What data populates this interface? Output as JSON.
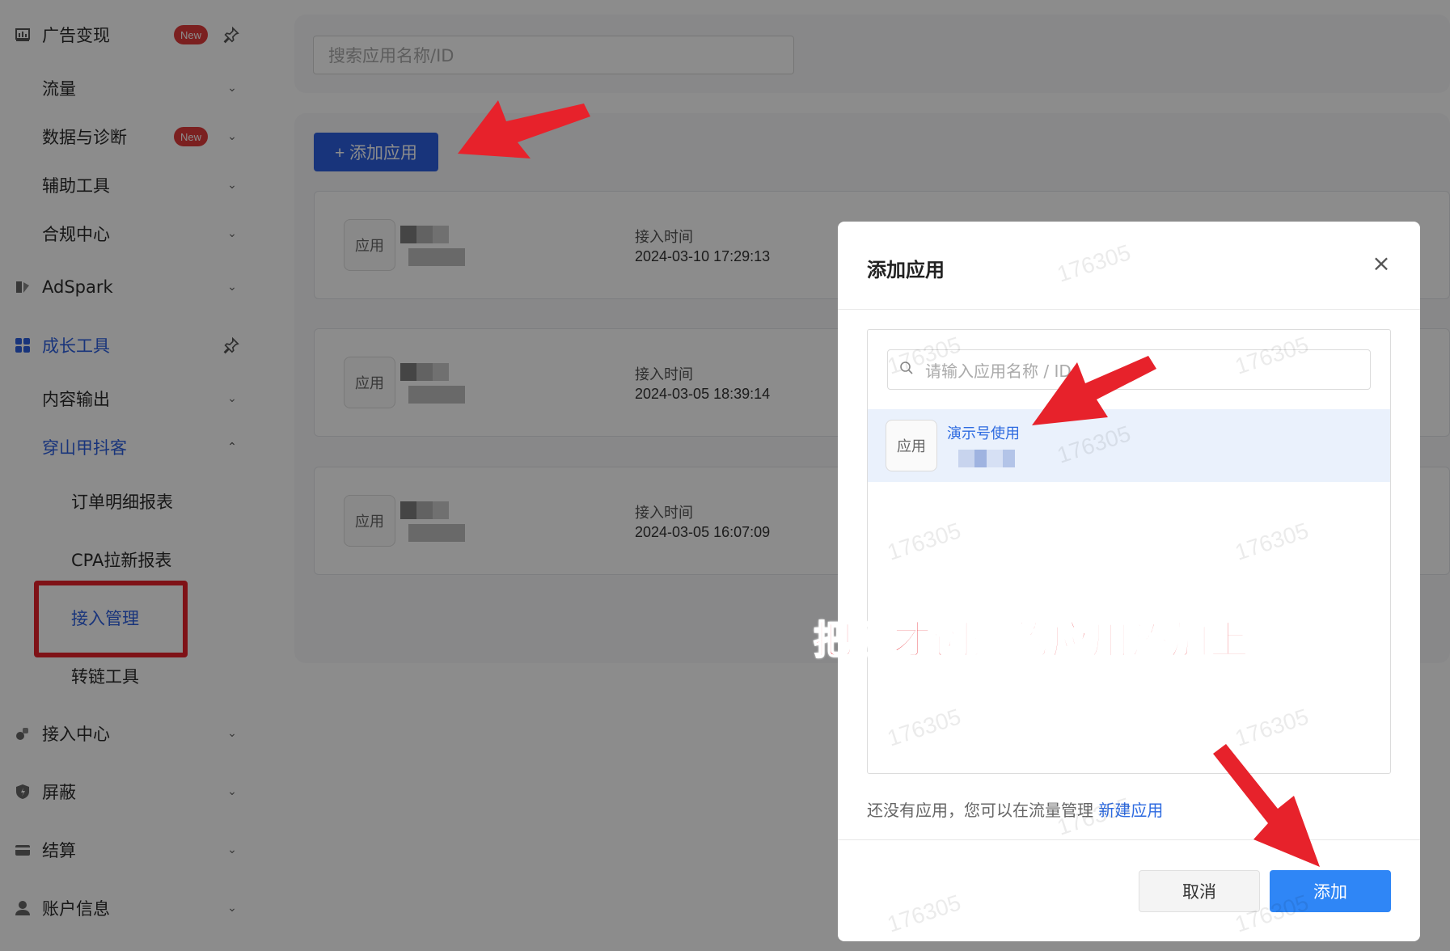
{
  "sidebar": {
    "items": [
      {
        "label": "广告变现",
        "badge": "New",
        "icon": "chart-icon"
      },
      {
        "label": "流量"
      },
      {
        "label": "数据与诊断",
        "badge": "New"
      },
      {
        "label": "辅助工具"
      },
      {
        "label": "合规中心"
      },
      {
        "label": "AdSpark",
        "icon": "adspark-icon"
      },
      {
        "label": "成长工具",
        "icon": "grid-icon"
      },
      {
        "label": "内容输出"
      },
      {
        "label": "穿山甲抖客"
      },
      {
        "label": "订单明细报表"
      },
      {
        "label": "CPA拉新报表"
      },
      {
        "label": "接入管理"
      },
      {
        "label": "转链工具"
      },
      {
        "label": "接入中心",
        "icon": "plug-icon"
      },
      {
        "label": "屏蔽",
        "icon": "shield-icon"
      },
      {
        "label": "结算",
        "icon": "card-icon"
      },
      {
        "label": "账户信息",
        "icon": "user-icon"
      }
    ]
  },
  "main": {
    "search_placeholder": "搜索应用名称/ID",
    "add_button": "+ 添加应用",
    "cards": [
      {
        "icon_label": "应用",
        "time_label": "接入时间",
        "time_value": "2024-03-10 17:29:13"
      },
      {
        "icon_label": "应用",
        "time_label": "接入时间",
        "time_value": "2024-03-05 18:39:14"
      },
      {
        "icon_label": "应用",
        "time_label": "接入时间",
        "time_value": "2024-03-05 16:07:09"
      }
    ]
  },
  "modal": {
    "title": "添加应用",
    "close": "×",
    "search_placeholder": "请输入应用名称 / ID",
    "row": {
      "icon_label": "应用",
      "name": "演示号使用"
    },
    "hint_text": "还没有应用，您可以在流量管理 ",
    "hint_link": "新建应用",
    "cancel": "取消",
    "confirm": "添加"
  },
  "annotation": "把刚才创建的应用添加上",
  "watermark": "176305",
  "colors": {
    "primary": "#2d5fe0",
    "confirm": "#2f86f6",
    "annotation_red": "#e7222b",
    "badge_red": "#e13b3b"
  }
}
